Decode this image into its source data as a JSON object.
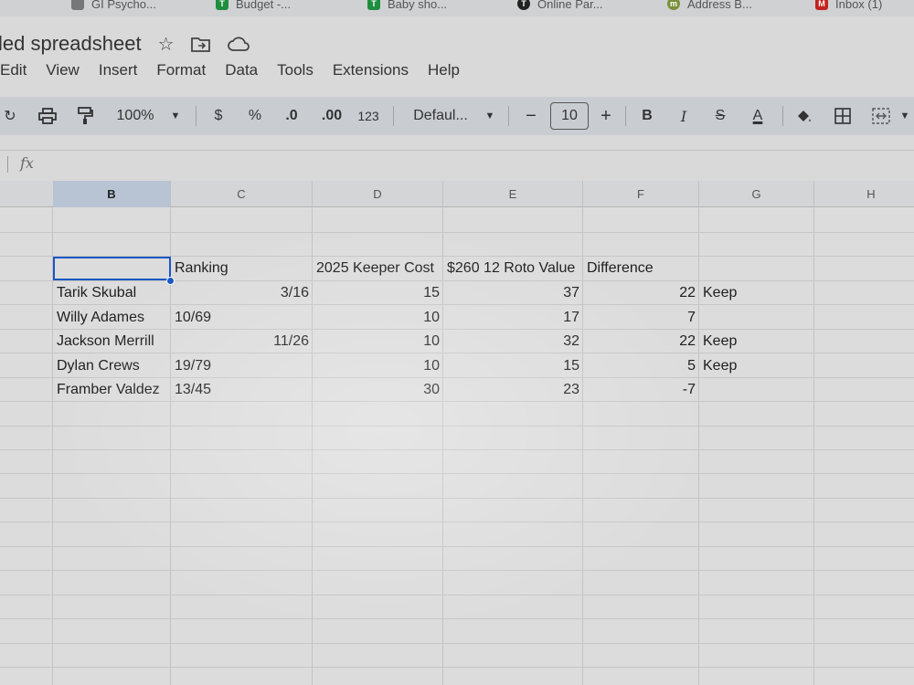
{
  "bookmarks": [
    {
      "label": "GI Psycho...",
      "icon": "bookmark-icon",
      "color": "#6b6b6b"
    },
    {
      "label": "Budget -...",
      "icon": "sheets-icon",
      "color": "#1e8e3e"
    },
    {
      "label": "Baby sho...",
      "icon": "sheets-icon",
      "color": "#1e8e3e"
    },
    {
      "label": "Online Par...",
      "icon": "site-icon",
      "color": "#222222"
    },
    {
      "label": "Address B...",
      "icon": "m-icon",
      "color": "#7a8f3a"
    },
    {
      "label": "Inbox (1)",
      "icon": "gmail-icon",
      "color": "#c5221f"
    }
  ],
  "document": {
    "title": "led spreadsheet"
  },
  "menu": [
    "Edit",
    "View",
    "Insert",
    "Format",
    "Data",
    "Tools",
    "Extensions",
    "Help"
  ],
  "toolbar": {
    "zoom": "100%",
    "currency": "$",
    "percent": "%",
    "decrease_decimal": ".0",
    "increase_decimal": ".00",
    "number_format": "123",
    "font": "Defaul...",
    "font_size": "10",
    "minus": "−",
    "plus": "+",
    "bold": "B",
    "italic": "I",
    "strikethrough": "S",
    "text_color": "A"
  },
  "formula_bar": {
    "fx": "fx",
    "value": ""
  },
  "columns": [
    "B",
    "C",
    "D",
    "E",
    "F",
    "G",
    "H"
  ],
  "selected_column": "B",
  "rows": [
    {
      "B": "",
      "C": "Ranking",
      "D": "2025 Keeper Cost",
      "E": "$260 12 Roto Value",
      "F": "Difference",
      "G": ""
    },
    {
      "B": "Tarik Skubal",
      "C": "3/16",
      "D": "15",
      "E": "37",
      "F": "22",
      "G": "Keep"
    },
    {
      "B": "Willy Adames",
      "C": "10/69",
      "D": "10",
      "E": "17",
      "F": "7",
      "G": ""
    },
    {
      "B": "Jackson Merrill",
      "C": "11/26",
      "D": "10",
      "E": "32",
      "F": "22",
      "G": "Keep"
    },
    {
      "B": "Dylan Crews",
      "C": "19/79",
      "D": "10",
      "E": "15",
      "F": "5",
      "G": "Keep"
    },
    {
      "B": "Framber Valdez",
      "C": "13/45",
      "D": "30",
      "E": "23",
      "F": "-7",
      "G": ""
    }
  ],
  "colors": {
    "selection": "#1a56c4",
    "toolbar": "#c9cdd2",
    "sheets_green": "#1e8e3e"
  }
}
